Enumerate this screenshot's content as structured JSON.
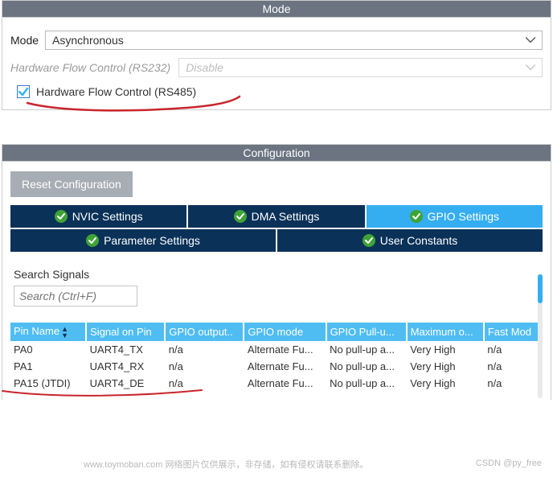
{
  "mode_panel": {
    "header": "Mode",
    "mode_label": "Mode",
    "mode_value": "Asynchronous",
    "hw232_label": "Hardware Flow Control (RS232)",
    "hw232_value": "Disable",
    "hw485_checked": true,
    "hw485_label": "Hardware Flow Control (RS485)"
  },
  "config_panel": {
    "header": "Configuration",
    "reset": "Reset Configuration",
    "tabs": {
      "nvic": "NVIC Settings",
      "dma": "DMA Settings",
      "gpio": "GPIO Settings",
      "param": "Parameter Settings",
      "user": "User Constants"
    },
    "signals": {
      "title": "Search Signals",
      "placeholder": "Search (Ctrl+F)"
    },
    "table": {
      "cols": [
        "Pin Name",
        "Signal on Pin",
        "GPIO output..",
        "GPIO mode",
        "GPIO Pull-u...",
        "Maximum o...",
        "Fast Mod"
      ],
      "rows": [
        {
          "pin": "PA0",
          "signal": "UART4_TX",
          "out": "n/a",
          "mode": "Alternate Fu...",
          "pull": "No pull-up a...",
          "max": "Very High",
          "fast": "n/a"
        },
        {
          "pin": "PA1",
          "signal": "UART4_RX",
          "out": "n/a",
          "mode": "Alternate Fu...",
          "pull": "No pull-up a...",
          "max": "Very High",
          "fast": "n/a"
        },
        {
          "pin": "PA15 (JTDI)",
          "signal": "UART4_DE",
          "out": "n/a",
          "mode": "Alternate Fu...",
          "pull": "No pull-up a...",
          "max": "Very High",
          "fast": "n/a"
        }
      ]
    }
  },
  "watermarks": {
    "left": "www.toymoban.com 网络图片仅供展示，非存储，如有侵权请联系删除。",
    "right": "CSDN @py_free"
  }
}
